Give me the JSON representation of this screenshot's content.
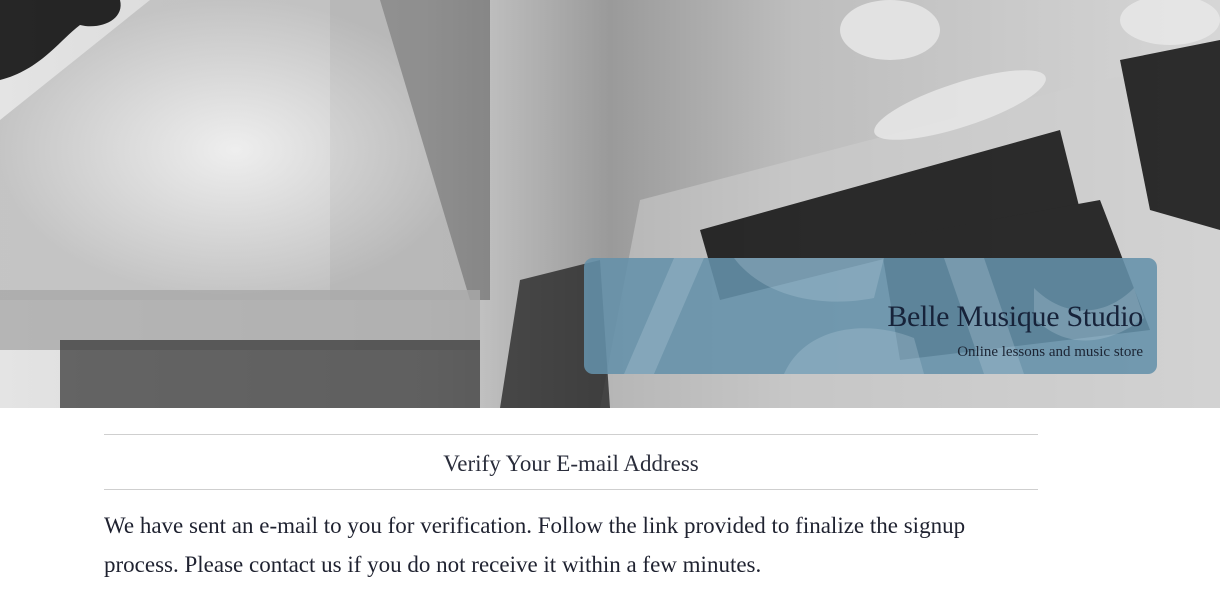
{
  "header": {
    "site_title": "Belle Musique Studio",
    "tagline": "Online lessons and music store",
    "overlay_color": "#6491aa"
  },
  "main": {
    "heading": "Verify Your E-mail Address",
    "message": "We have sent an e-mail to you for verification. Follow the link provided to finalize the signup process. Please contact us if you do not receive it within a few minutes."
  },
  "hero": {
    "image_description_icon": "hero-photo-music-stand"
  }
}
